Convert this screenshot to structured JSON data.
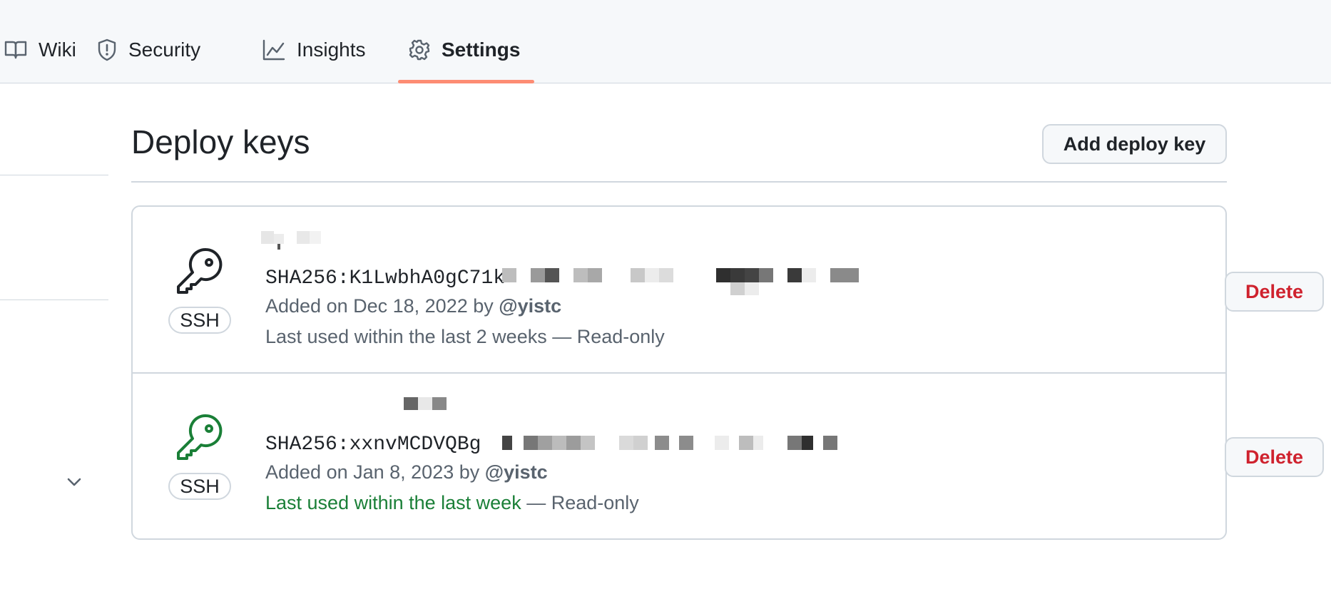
{
  "nav": {
    "tabs": [
      {
        "label": "Wiki",
        "icon": "book-icon"
      },
      {
        "label": "Security",
        "icon": "shield-icon"
      },
      {
        "label": "Insights",
        "icon": "graph-icon"
      },
      {
        "label": "Settings",
        "icon": "gear-icon",
        "selected": true
      }
    ],
    "accent_color": "#fd8c73"
  },
  "page": {
    "title": "Deploy keys",
    "add_button_label": "Add deploy key"
  },
  "keys": [
    {
      "type_label": "SSH",
      "icon": "key-icon",
      "icon_color": "#1f2328",
      "fingerprint": "SHA256:K1LwbhA0gC71k",
      "added_prefix": "Added on Dec 18, 2022 by",
      "added_by": "@yistc",
      "last_used": "Last used within the last 2 weeks",
      "access": "— Read-only",
      "delete_label": "Delete"
    },
    {
      "type_label": "SSH",
      "icon": "key-icon",
      "icon_color": "#1a7f37",
      "fingerprint": "SHA256:xxnvMCDVQBg",
      "added_prefix": "Added on Jan 8, 2023 by",
      "added_by": "@yistc",
      "last_used": "Last used within the last week",
      "access": "— Read-only",
      "delete_label": "Delete"
    }
  ]
}
